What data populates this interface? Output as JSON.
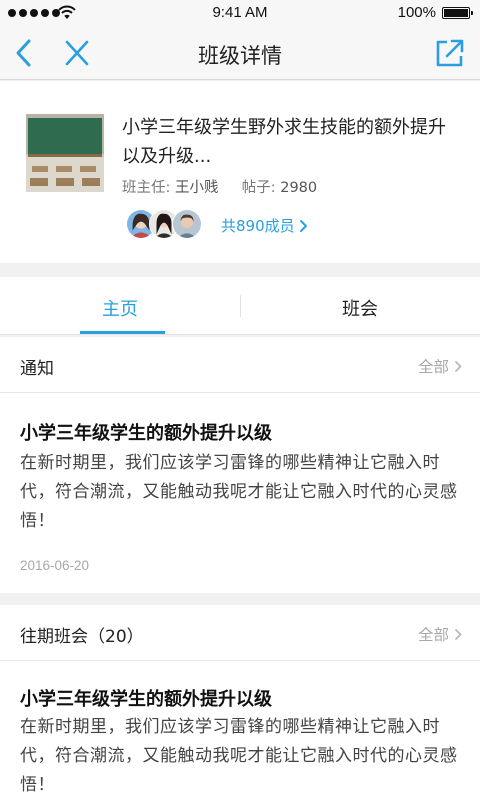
{
  "status_bar": {
    "time": "9:41 AM",
    "battery": "100%"
  },
  "nav": {
    "title": "班级详情"
  },
  "class_info": {
    "name": "小学三年级学生野外求生技能的额外提升以及升级...",
    "teacher_label": "班主任:",
    "teacher": "王小贱",
    "posts_label": "帖子:",
    "posts": "2980",
    "members_link": "共890成员"
  },
  "tabs": [
    {
      "label": "主页",
      "active": true
    },
    {
      "label": "班会",
      "active": false
    }
  ],
  "notice": {
    "title": "通知",
    "more": "全部",
    "post": {
      "title": "小学三年级学生的额外提升以级",
      "body": "在新时期里，我们应该学习雷锋的哪些精神让它融入时代，符合潮流，又能触动我呢才能让它融入时代的心灵感悟！",
      "date": "2016-06-20"
    }
  },
  "past_meetings": {
    "title": "往期班会（20）",
    "more": "全部",
    "post": {
      "title": "小学三年级学生的额外提升以级",
      "body": "在新时期里，我们应该学习雷锋的哪些精神让它融入时代，符合潮流，又能触动我呢才能让它融入时代的心灵感悟！"
    }
  },
  "colors": {
    "accent": "#2a9fe0",
    "muted": "#a8a8a8",
    "background": "#f1f1f1"
  }
}
